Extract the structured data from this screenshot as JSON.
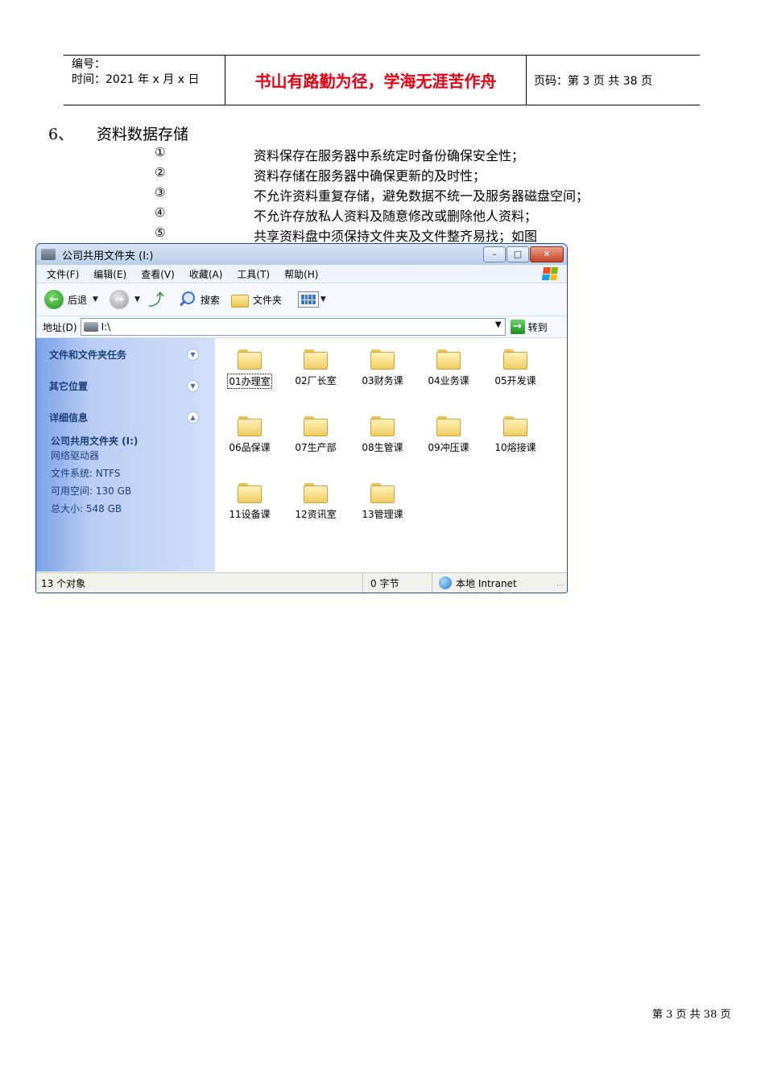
{
  "header": {
    "number_label": "编号：",
    "time_label": "时间：2021 年 x 月 x 日",
    "motto": "书山有路勤为径，学海无涯苦作舟",
    "page_code": "页码：第 3 页 共 38 页"
  },
  "section": {
    "number": "6、",
    "title": "资料数据存储",
    "items": [
      {
        "mark": "①",
        "text": "资料保存在服务器中系统定时备份确保安全性；"
      },
      {
        "mark": "②",
        "text": "资料存储在服务器中确保更新的及时性；"
      },
      {
        "mark": "③",
        "text": "不允许资料重复存储，避免数据不统一及服务器磁盘空间；"
      },
      {
        "mark": "④",
        "text": "不允许存放私人资料及随意修改或删除他人资料；"
      },
      {
        "mark": "⑤",
        "text": "共享资料盘中须保持文件夹及文件整齐易找；如图"
      }
    ]
  },
  "window": {
    "title": "公司共用文件夹 (I:)",
    "buttons": {
      "minimize": "–",
      "maximize": "□",
      "close": "✕"
    },
    "menu": [
      "文件(F)",
      "编辑(E)",
      "查看(V)",
      "收藏(A)",
      "工具(T)",
      "帮助(H)"
    ],
    "toolbar": {
      "back": "后退",
      "search": "搜索",
      "folders": "文件夹"
    },
    "address": {
      "label": "地址(D)",
      "value": "I:\\",
      "go": "转到"
    },
    "taskpane": {
      "sections": [
        "文件和文件夹任务",
        "其它位置",
        "详细信息"
      ],
      "details": {
        "name": "公司共用文件夹 (I:)",
        "type": "网络驱动器",
        "filesystem": "文件系统: NTFS",
        "free": "可用空间: 130 GB",
        "total": "总大小: 548 GB"
      }
    },
    "folders": [
      "01办理室",
      "02厂长室",
      "03财务课",
      "04业务课",
      "05开发课",
      "06品保课",
      "07生产部",
      "08生管课",
      "09冲压课",
      "10熔接课",
      "11设备课",
      "12资讯室",
      "13管理课"
    ],
    "status": {
      "objects": "13 个对象",
      "size": "0 字节",
      "zone": "本地 Intranet"
    }
  },
  "footer": {
    "page": "第 3 页 共 38 页"
  },
  "colors": {
    "motto": "#e60012",
    "window_border": "#1f4b9c",
    "taskpane": "#d2e0f8"
  }
}
